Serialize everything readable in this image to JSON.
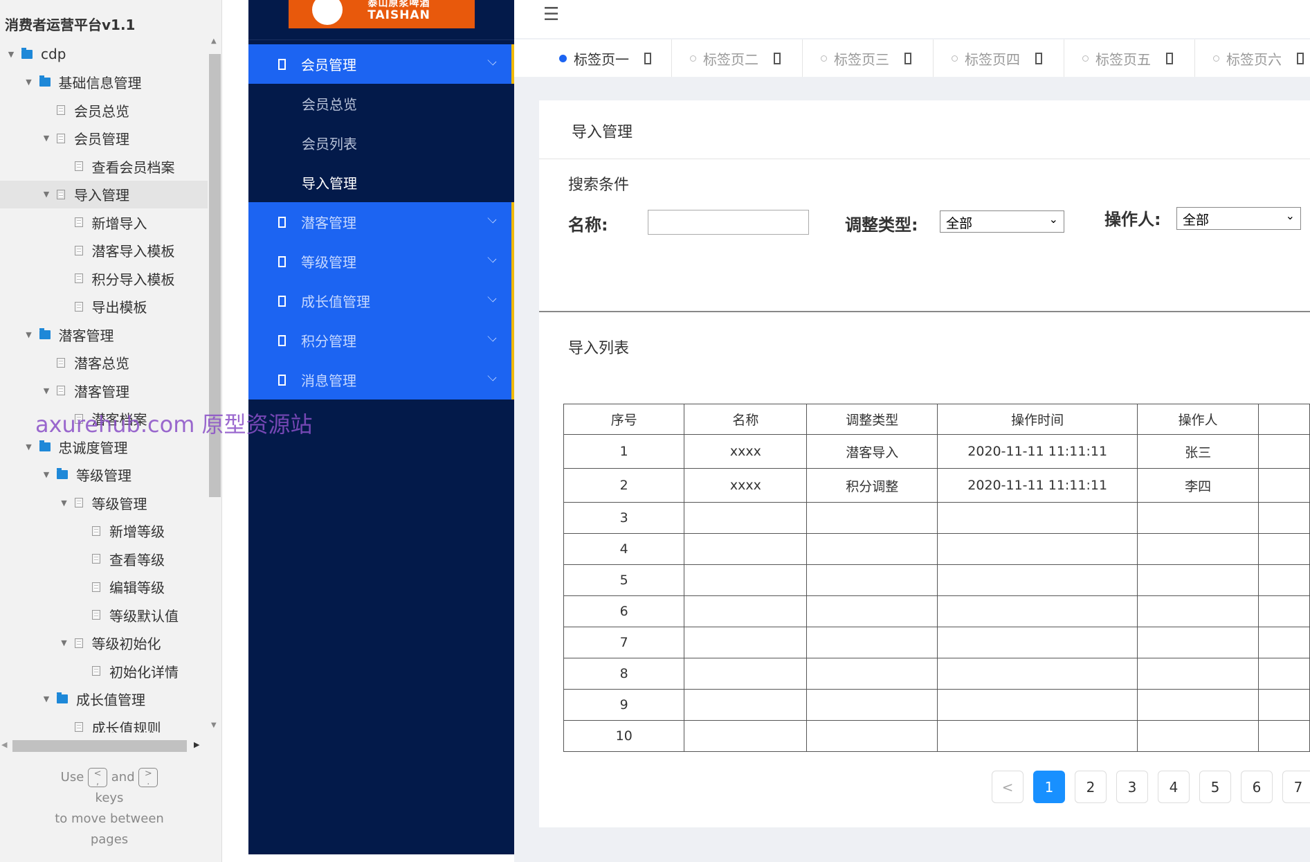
{
  "tree_panel": {
    "title": "消费者运营平台v1.1",
    "items": [
      {
        "label": "cdp",
        "level": 0,
        "type": "folder",
        "expanded": true
      },
      {
        "label": "基础信息管理",
        "level": 1,
        "type": "folder",
        "expanded": true
      },
      {
        "label": "会员总览",
        "level": 2,
        "type": "page"
      },
      {
        "label": "会员管理",
        "level": 2,
        "type": "page",
        "expanded": true
      },
      {
        "label": "查看会员档案",
        "level": 3,
        "type": "page"
      },
      {
        "label": "导入管理",
        "level": 2,
        "type": "page",
        "expanded": true,
        "selected": true
      },
      {
        "label": "新增导入",
        "level": 3,
        "type": "page"
      },
      {
        "label": "潜客导入模板",
        "level": 3,
        "type": "page"
      },
      {
        "label": "积分导入模板",
        "level": 3,
        "type": "page"
      },
      {
        "label": "导出模板",
        "level": 3,
        "type": "page"
      },
      {
        "label": "潜客管理",
        "level": 1,
        "type": "folder",
        "expanded": true
      },
      {
        "label": "潜客总览",
        "level": 2,
        "type": "page"
      },
      {
        "label": "潜客管理",
        "level": 2,
        "type": "page",
        "expanded": true
      },
      {
        "label": "潜客档案",
        "level": 3,
        "type": "page"
      },
      {
        "label": "忠诚度管理",
        "level": 1,
        "type": "folder",
        "expanded": true
      },
      {
        "label": "等级管理",
        "level": 2,
        "type": "folder",
        "expanded": true
      },
      {
        "label": "等级管理",
        "level": 3,
        "type": "page",
        "expanded": true
      },
      {
        "label": "新增等级",
        "level": 4,
        "type": "page"
      },
      {
        "label": "查看等级",
        "level": 4,
        "type": "page"
      },
      {
        "label": "编辑等级",
        "level": 4,
        "type": "page"
      },
      {
        "label": "等级默认值",
        "level": 4,
        "type": "page"
      },
      {
        "label": "等级初始化",
        "level": 3,
        "type": "page",
        "expanded": true
      },
      {
        "label": "初始化详情",
        "level": 4,
        "type": "page"
      },
      {
        "label": "成长值管理",
        "level": 2,
        "type": "folder",
        "expanded": true
      },
      {
        "label": "成长值规则",
        "level": 3,
        "type": "page"
      }
    ],
    "help": {
      "use": "Use",
      "key_prev": "<\n,",
      "and": "and",
      "key_next": ">\n.",
      "keys": "keys",
      "line3": "to move between",
      "line4": "pages"
    }
  },
  "watermark": "axurehub.com 原型资源站",
  "sidebar": {
    "logo_text": "泰山原浆啤酒",
    "logo_sub": "TAISHAN",
    "menu": [
      {
        "label": "会员管理",
        "expanded": true,
        "children": [
          {
            "label": "会员总览"
          },
          {
            "label": "会员列表"
          },
          {
            "label": "导入管理",
            "active": true
          }
        ]
      },
      {
        "label": "潜客管理"
      },
      {
        "label": "等级管理"
      },
      {
        "label": "成长值管理"
      },
      {
        "label": "积分管理"
      },
      {
        "label": "消息管理"
      }
    ]
  },
  "tabs": [
    {
      "label": "标签页一",
      "active": true
    },
    {
      "label": "标签页二"
    },
    {
      "label": "标签页三"
    },
    {
      "label": "标签页四"
    },
    {
      "label": "标签页五"
    },
    {
      "label": "标签页六"
    }
  ],
  "card": {
    "title": "导入管理",
    "search_title": "搜索条件",
    "name_label": "名称:",
    "name_value": "",
    "type_label": "调整类型:",
    "type_value": "全部",
    "operator_label": "操作人:",
    "operator_value": "全部",
    "list_title": "导入列表"
  },
  "table": {
    "columns": [
      "序号",
      "名称",
      "调整类型",
      "操作时间",
      "操作人",
      ""
    ],
    "rows": [
      [
        "1",
        "xxxx",
        "潜客导入",
        "2020-11-11 11:11:11",
        "张三",
        ""
      ],
      [
        "2",
        "xxxx",
        "积分调整",
        "2020-11-11 11:11:11",
        "李四",
        ""
      ],
      [
        "3",
        "",
        "",
        "",
        "",
        ""
      ],
      [
        "4",
        "",
        "",
        "",
        "",
        ""
      ],
      [
        "5",
        "",
        "",
        "",
        "",
        ""
      ],
      [
        "6",
        "",
        "",
        "",
        "",
        ""
      ],
      [
        "7",
        "",
        "",
        "",
        "",
        ""
      ],
      [
        "8",
        "",
        "",
        "",
        "",
        ""
      ],
      [
        "9",
        "",
        "",
        "",
        "",
        ""
      ],
      [
        "10",
        "",
        "",
        "",
        "",
        ""
      ]
    ]
  },
  "pagination": {
    "prev": "<",
    "pages": [
      "1",
      "2",
      "3",
      "4",
      "5",
      "6",
      "7"
    ],
    "current": "1"
  },
  "colors": {
    "sidebar_bg": "#031a4a",
    "menu_blue": "#1c64f2",
    "accent_yellow": "#f0b90b",
    "logo_orange": "#e8590c",
    "page_active": "#1890ff"
  }
}
